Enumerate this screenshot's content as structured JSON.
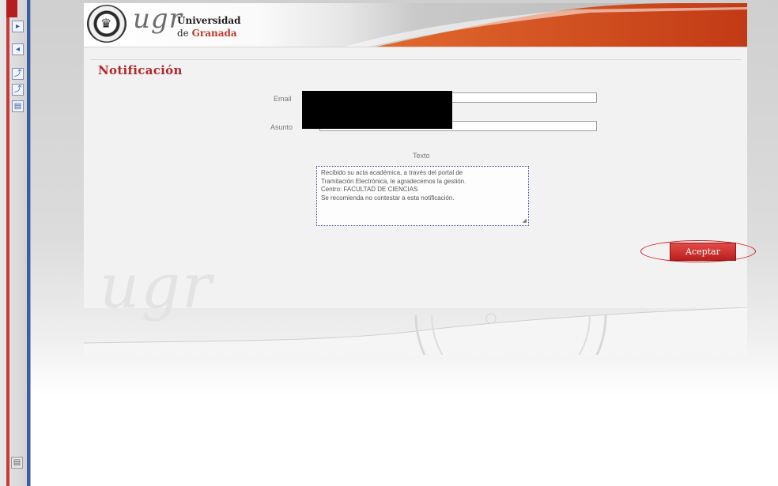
{
  "header": {
    "logo_text": "ugr",
    "university_line1": "Universidad",
    "university_de": "de",
    "university_city": "Granada"
  },
  "panel": {
    "title": "Notificación",
    "email_label": "Email",
    "asunto_label": "Asunto",
    "texto_label": "Texto",
    "message_lines": [
      "Recibido su acta académica, a través del portal de",
      "Tramitación Electrónica, le agradecemos la gestión.",
      "Centro: FACULTAD DE CIENCIAS",
      "Se recomienda no contestar a esta notificación."
    ],
    "accept_label": "Aceptar",
    "watermark_text": "ugr"
  },
  "colors": {
    "brand_red": "#b3262b",
    "header_orange": "#d34a1f",
    "annotation_red": "#d21414"
  },
  "icons": {
    "crest": "university-crest-icon",
    "toolbar": [
      "arrow-icon",
      "up-arrow-icon",
      "up-arrow-icon",
      "form-icon"
    ]
  }
}
